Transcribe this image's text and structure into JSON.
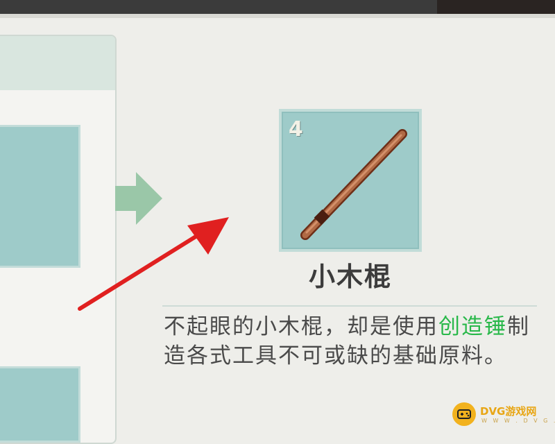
{
  "result": {
    "count": "4",
    "icon": "wooden-stick-icon",
    "name": "小木棍"
  },
  "description": {
    "part1": "不起眼的小木棍，却是使用",
    "highlight": "创造锤",
    "part2": "制造各式工具不可或缺的基础原料。"
  },
  "colors": {
    "highlight": "#29b84a",
    "slot": "#9ecbc9",
    "annotation_arrow": "#e02020",
    "craft_arrow": "#9ac7a8"
  },
  "watermark": {
    "brand": "DVG游戏网",
    "url": "W W W . D V G . C N"
  }
}
